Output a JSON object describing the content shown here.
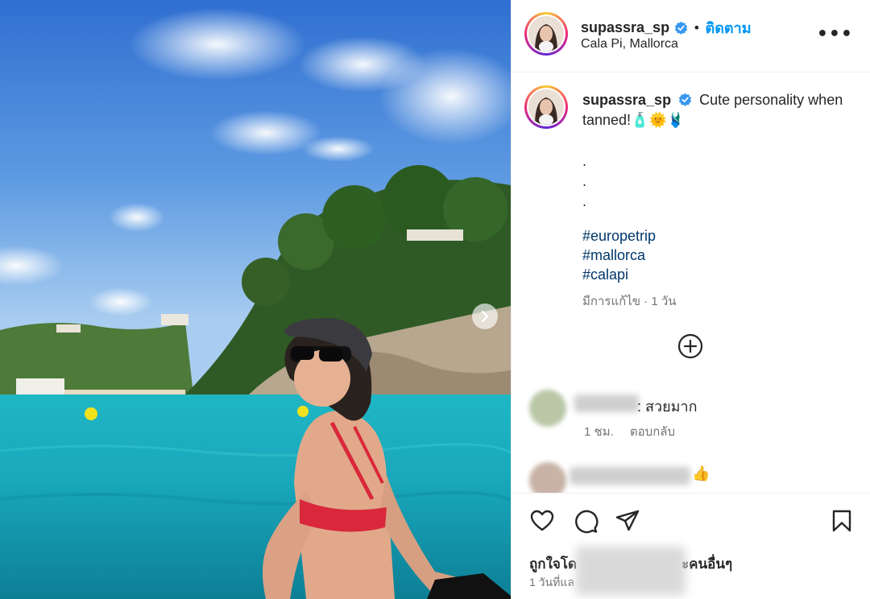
{
  "post": {
    "author": {
      "username": "supassra_sp",
      "follow_label": "ติดตาม",
      "location": "Cala Pi, Mallorca",
      "more_icon": "more-horizontal-icon"
    },
    "caption": {
      "username": "supassra_sp",
      "text": "Cute personality when tanned!",
      "emojis": "🧴🌞🩱",
      "dots": [
        ".",
        ".",
        "."
      ],
      "hashtags": [
        "#europetrip",
        "#mallorca",
        "#calapi"
      ],
      "edited_meta": "มีการแก้ไข · 1 วัน"
    },
    "comments": [
      {
        "text": ": สวยมาก",
        "time": "1 ชม.",
        "reply_label": "ตอบกลับ"
      },
      {
        "text": "👍"
      }
    ],
    "actions": {
      "liked_by_prefix": "ถูกใจโด",
      "liked_by_suffix": "ะคนอื่นๆ",
      "time_ago": "1 วันที่แล"
    }
  },
  "colors": {
    "accent": "#0095f6",
    "hashtag": "#00376b",
    "muted": "#737373",
    "verified": "#3897f0"
  }
}
